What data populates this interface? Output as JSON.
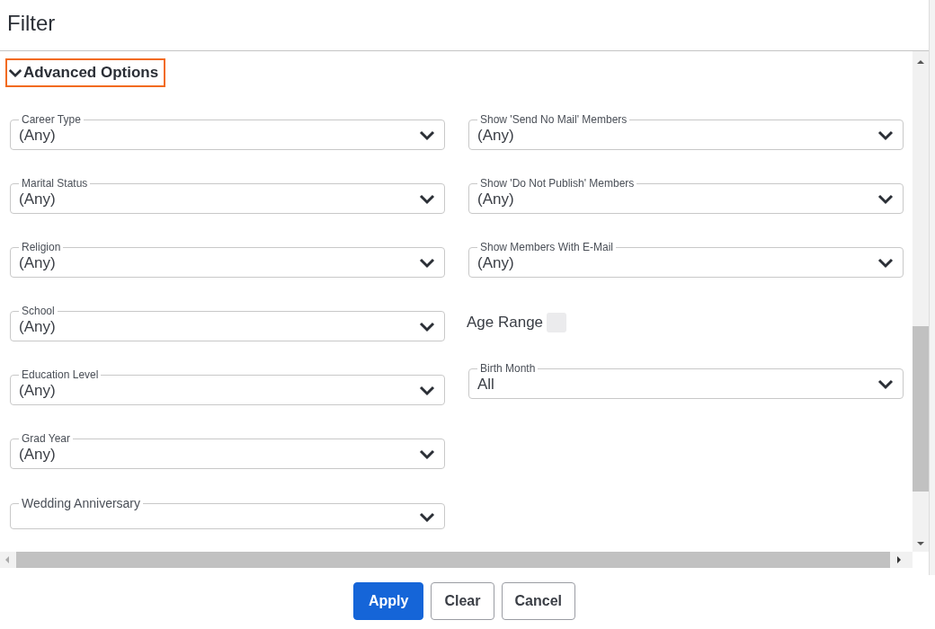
{
  "dialog": {
    "title": "Filter"
  },
  "section": {
    "title": "Advanced Options",
    "expanded": true
  },
  "left_fields": [
    {
      "kind": "select",
      "label": "Career Type",
      "value": "(Any)"
    },
    {
      "kind": "select",
      "label": "Marital Status",
      "value": "(Any)"
    },
    {
      "kind": "select",
      "label": "Religion",
      "value": "(Any)"
    },
    {
      "kind": "select",
      "label": "School",
      "value": "(Any)"
    },
    {
      "kind": "select",
      "label": "Education Level",
      "value": "(Any)"
    },
    {
      "kind": "select",
      "label": "Grad Year",
      "value": "(Any)"
    },
    {
      "kind": "select",
      "label": "Wedding Anniversary"
    }
  ],
  "right_fields": [
    {
      "kind": "select",
      "label": "Show 'Send No Mail' Members",
      "value": "(Any)"
    },
    {
      "kind": "select",
      "label": "Show 'Do Not Publish' Members",
      "value": "(Any)"
    },
    {
      "kind": "select",
      "label": "Show Members With E-Mail",
      "value": "(Any)"
    },
    {
      "kind": "checkbox",
      "label": "Age Range",
      "checked": false
    },
    {
      "kind": "select",
      "label": "Birth Month",
      "value": "All"
    }
  ],
  "buttons": [
    {
      "label": "Apply",
      "primary": true
    },
    {
      "label": "Clear",
      "primary": false
    },
    {
      "label": "Cancel",
      "primary": false
    }
  ]
}
